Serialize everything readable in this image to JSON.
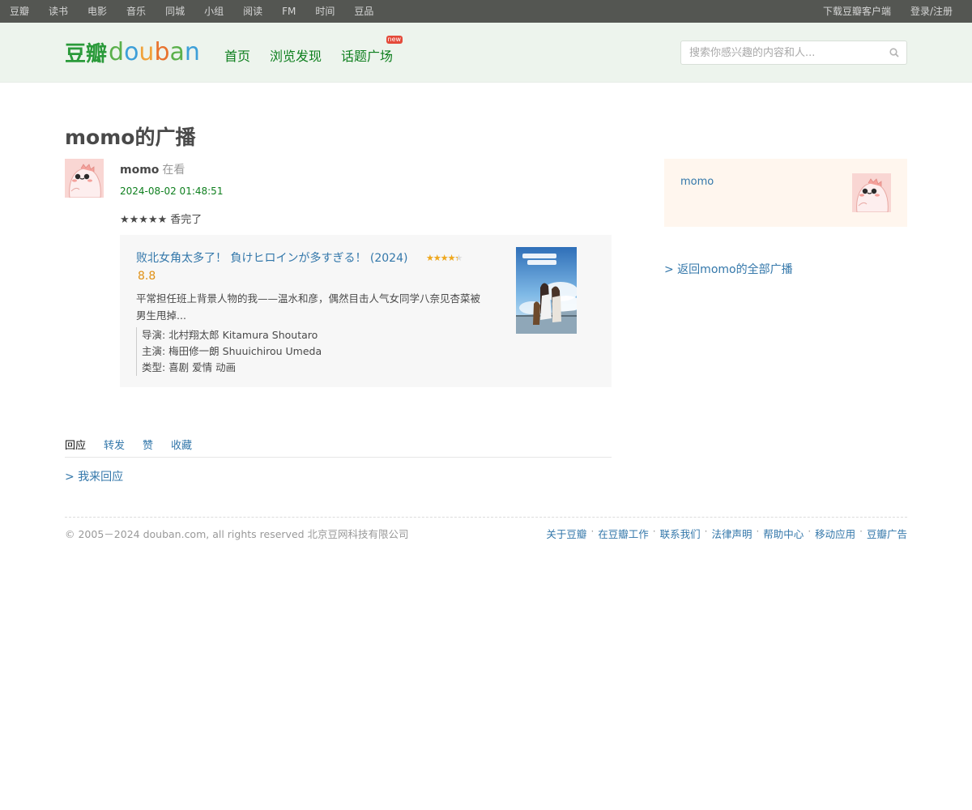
{
  "topbar": {
    "nav": [
      "豆瓣",
      "读书",
      "电影",
      "音乐",
      "同城",
      "小组",
      "阅读",
      "FM",
      "时间",
      "豆品"
    ],
    "download": "下载豆瓣客户端",
    "login": "登录/注册"
  },
  "header": {
    "logo_cn": "豆瓣",
    "logo_en": [
      "d",
      "o",
      "u",
      "b",
      "a",
      "n"
    ],
    "nav": [
      "首页",
      "浏览发现",
      "话题广场"
    ],
    "new_badge": "new",
    "search_placeholder": "搜索你感兴趣的内容和人..."
  },
  "page": {
    "title": "momo的广播"
  },
  "status": {
    "user": "momo",
    "action": "在看",
    "timestamp": "2024-08-02 01:48:51",
    "rating_stars": "★★★★★",
    "rating_text": "香完了"
  },
  "card": {
    "title": "败北女角太多了！ 負けヒロインが多すぎる！ (2024)",
    "stars": "★★★★★",
    "score": "8.8",
    "description": "平常担任班上背景人物的我——温水和彦，偶然目击人气女同学八奈见杏菜被男生甩掉...",
    "director": "导演: 北村翔太郎 Kitamura Shoutaro",
    "cast": "主演: 梅田修一朗 Shuuichirou Umeda",
    "genre": "类型: 喜剧 爱情 动画",
    "rating_fraction": 0.88
  },
  "tabs": {
    "items": [
      "回应",
      "转发",
      "赞",
      "收藏"
    ],
    "active": 0
  },
  "reply_link": "> 我来回应",
  "sidebar": {
    "name": "momo",
    "back_link": "> 返回momo的全部广播"
  },
  "footer": {
    "copyright": "© 2005－2024 douban.com, all rights reserved 北京豆网科技有限公司",
    "links": [
      "关于豆瓣",
      "在豆瓣工作",
      "联系我们",
      "法律声明",
      "帮助中心",
      "移动应用",
      "豆瓣广告"
    ],
    "separator": "·"
  }
}
